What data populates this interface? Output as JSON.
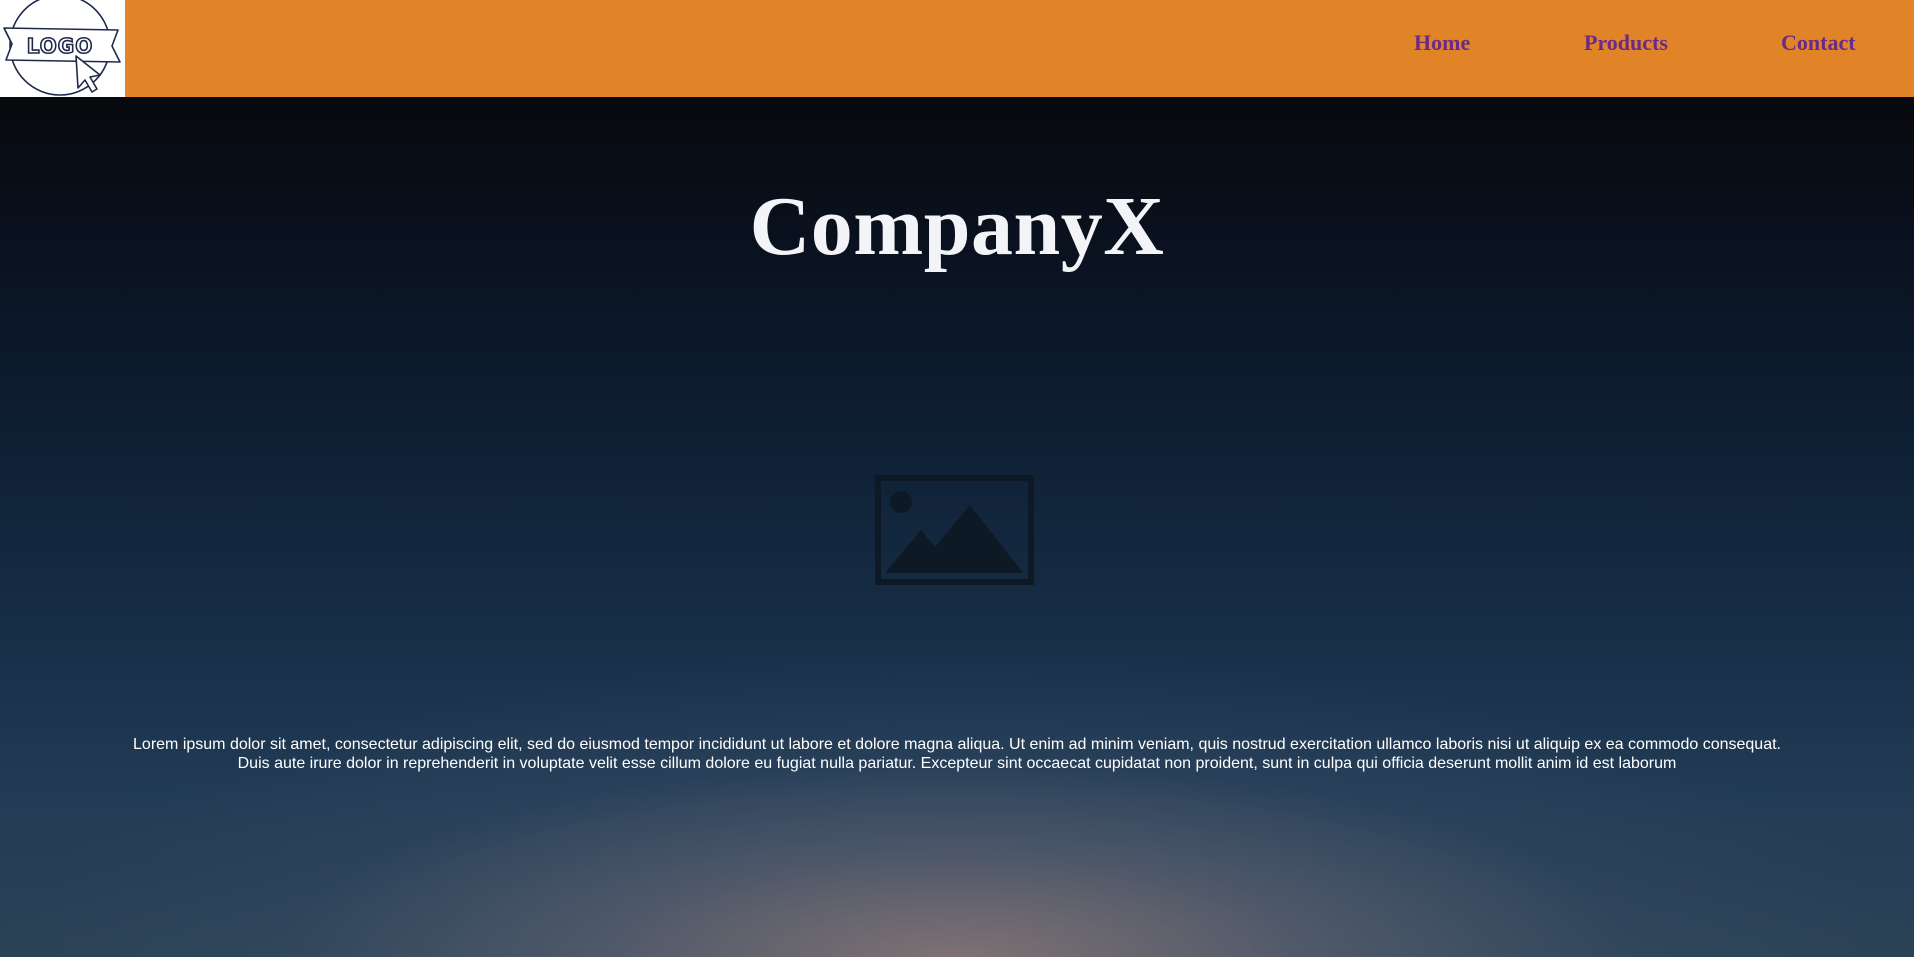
{
  "header": {
    "logo_text": "LOGO",
    "nav": [
      {
        "label": "Home"
      },
      {
        "label": "Products"
      },
      {
        "label": "Contact"
      }
    ]
  },
  "hero": {
    "title": "CompanyX",
    "image_icon": "image-placeholder-icon",
    "body": "Lorem ipsum dolor sit amet, consectetur adipiscing elit, sed do eiusmod tempor incididunt ut labore et dolore magna aliqua. Ut enim ad minim veniam, quis nostrud exercitation ullamco laboris nisi ut aliquip ex ea commodo consequat. Duis aute irure dolor in reprehenderit in voluptate velit esse cillum dolore eu fugiat nulla pariatur. Excepteur sint occaecat cupidatat non proident, sunt in culpa qui officia deserunt mollit anim id est laborum"
  },
  "colors": {
    "navbar": "#e08427",
    "nav_link": "#6a2a86",
    "title": "#f3f4f8",
    "logo_ink": "#1f2a4a"
  }
}
